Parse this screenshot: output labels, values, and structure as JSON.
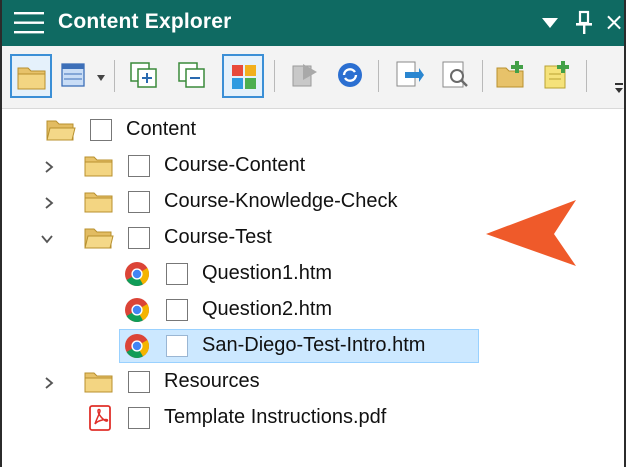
{
  "panel": {
    "title": "Content Explorer",
    "title_bar_color": "#0f6a62",
    "controls": [
      "dropdown-icon",
      "pin-icon",
      "close-icon"
    ],
    "close_glyph": "×"
  },
  "toolbar": {
    "buttons": [
      {
        "icon": "open-folder-icon",
        "active": true
      },
      {
        "icon": "list-view-icon",
        "active": false,
        "has_dropdown": true
      },
      {
        "icon": "expand-all-icon",
        "active": false
      },
      {
        "icon": "collapse-all-icon",
        "active": false
      },
      {
        "icon": "color-grid-icon",
        "active": true
      },
      {
        "icon": "previous-icon",
        "active": false,
        "disabled": true
      },
      {
        "icon": "refresh-icon",
        "active": false
      },
      {
        "icon": "send-icon",
        "active": false
      },
      {
        "icon": "properties-icon",
        "active": false
      },
      {
        "icon": "new-folder-icon",
        "active": false
      },
      {
        "icon": "new-file-icon",
        "active": false
      }
    ]
  },
  "tree": {
    "root": {
      "label": "Content",
      "icon": "open-folder-icon"
    },
    "items": [
      {
        "label": "Course-Content",
        "icon": "folder-icon",
        "expander": "collapsed"
      },
      {
        "label": "Course-Knowledge-Check",
        "icon": "folder-icon",
        "expander": "collapsed"
      },
      {
        "label": "Course-Test",
        "icon": "open-folder-icon",
        "expander": "expanded"
      },
      {
        "label": "Question1.htm",
        "icon": "chrome-icon",
        "level": 2
      },
      {
        "label": "Question2.htm",
        "icon": "chrome-icon",
        "level": 2
      },
      {
        "label": "San-Diego-Test-Intro.htm",
        "icon": "chrome-icon",
        "level": 2,
        "selected": true
      },
      {
        "label": "Resources",
        "icon": "folder-icon",
        "expander": "collapsed"
      },
      {
        "label": "Template Instructions.pdf",
        "icon": "pdf-icon"
      }
    ]
  },
  "callout": {
    "icon": "pointer-arrow-icon",
    "color": "#ef5a2a"
  }
}
